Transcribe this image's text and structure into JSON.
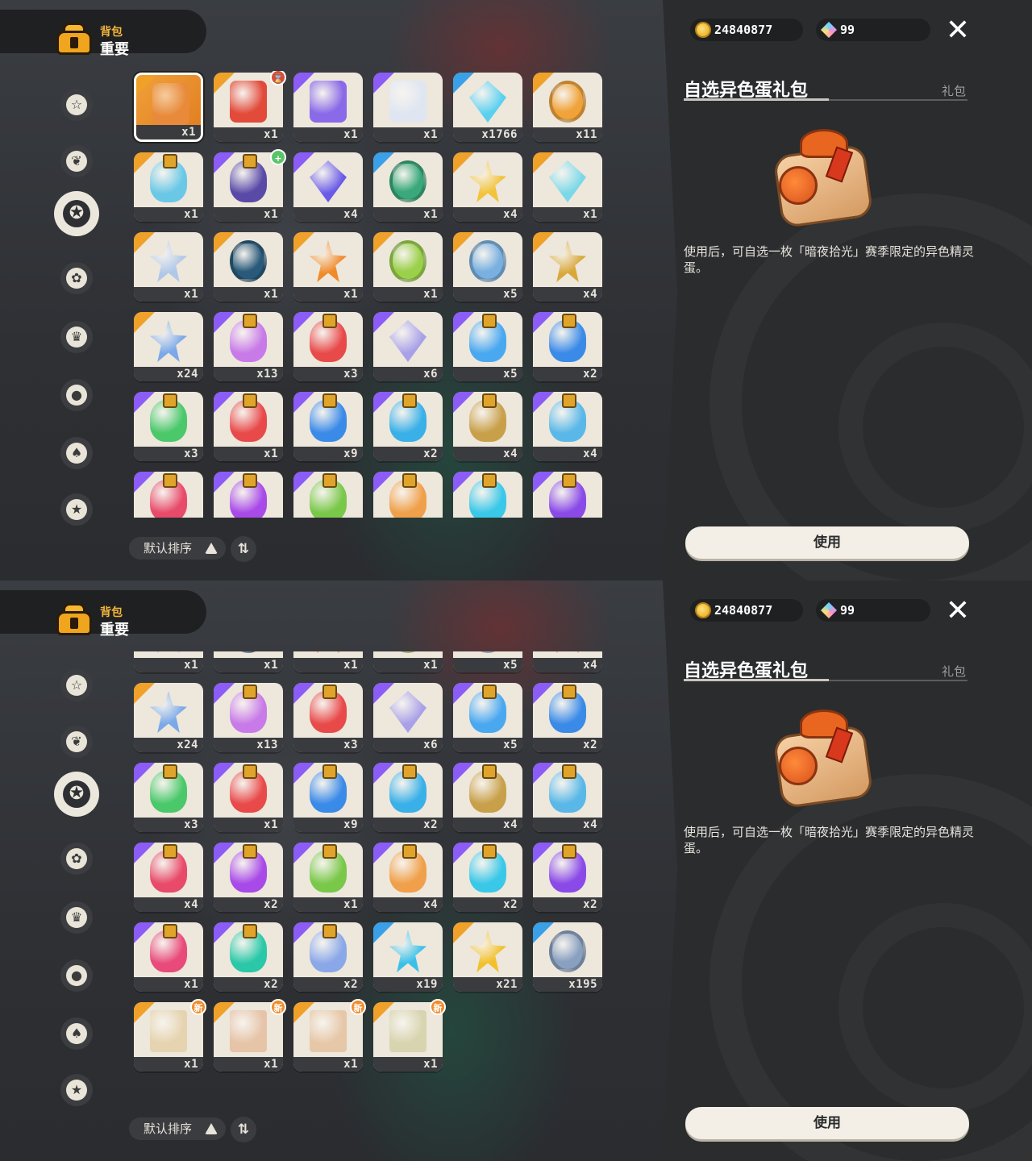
{
  "header": {
    "subtitle": "背包",
    "title": "重要"
  },
  "currency": {
    "gold": "24840877",
    "gems": "99"
  },
  "detail": {
    "name": "自选异色蛋礼包",
    "type": "礼包",
    "description": "使用后，可自选一枚「暗夜拾光」赛季限定的异色精灵蛋。",
    "use_label": "使用"
  },
  "sort": {
    "label": "默认排序",
    "toggle_glyph": "⇅"
  },
  "categories": [
    {
      "icon": "star-outline-icon",
      "glyph": "☆"
    },
    {
      "icon": "leaf-icon",
      "glyph": "❦"
    },
    {
      "icon": "star-burst-icon",
      "glyph": "✪"
    },
    {
      "icon": "flower-leaf-icon",
      "glyph": "✿"
    },
    {
      "icon": "card-crown-icon",
      "glyph": "♛"
    },
    {
      "icon": "egg-dots-icon",
      "glyph": "●"
    },
    {
      "icon": "acorn-icon",
      "glyph": "♠"
    },
    {
      "icon": "sofa-icon",
      "glyph": "★"
    }
  ],
  "rows": [
    [
      {
        "c": "x1",
        "k": "box",
        "col": "#e88a3a",
        "rar": "#f0a12a",
        "sel": true
      },
      {
        "c": "x1",
        "k": "box",
        "col": "#e24a3a",
        "rar": "#f0a12a",
        "badge": "timer"
      },
      {
        "c": "x1",
        "k": "box",
        "col": "#8a6ae8",
        "rar": "#8b5cf6"
      },
      {
        "c": "x1",
        "k": "box",
        "col": "#dfe6f2",
        "rar": "#8b5cf6"
      },
      {
        "c": "x1766",
        "k": "gem",
        "col": "#5ad0f0",
        "rar": "#3aa0e8"
      },
      {
        "c": "x11",
        "k": "coin",
        "col": "#f0a33a",
        "rar": "#f0a12a"
      }
    ],
    [
      {
        "c": "x1",
        "k": "bottle",
        "col": "#6ac8e6",
        "rar": "#f0a12a"
      },
      {
        "c": "x1",
        "k": "bottle",
        "col": "#5a4aa8",
        "rar": "#8b5cf6",
        "badge": "up"
      },
      {
        "c": "x4",
        "k": "gem",
        "col": "#6a5ae8",
        "rar": "#8b5cf6"
      },
      {
        "c": "x1",
        "k": "coin",
        "col": "#3aa87a",
        "rar": "#3aa0e8"
      },
      {
        "c": "x4",
        "k": "star",
        "col": "#f2c33a",
        "rar": "#f0a12a"
      },
      {
        "c": "x1",
        "k": "gem",
        "col": "#7ad8e8",
        "rar": "#f0a12a"
      }
    ],
    [
      {
        "c": "x1",
        "k": "star",
        "col": "#b0c8e8",
        "rar": "#f0a12a"
      },
      {
        "c": "x1",
        "k": "coin",
        "col": "#2a5a7a",
        "rar": "#f0a12a"
      },
      {
        "c": "x1",
        "k": "star",
        "col": "#f08a2a",
        "rar": "#f0a12a"
      },
      {
        "c": "x1",
        "k": "coin",
        "col": "#9ad04a",
        "rar": "#f0a12a"
      },
      {
        "c": "x5",
        "k": "coin",
        "col": "#7ab0e0",
        "rar": "#f0a12a"
      },
      {
        "c": "x4",
        "k": "star",
        "col": "#d8a83a",
        "rar": "#f0a12a"
      }
    ],
    [
      {
        "c": "x24",
        "k": "star",
        "col": "#7aa8e8",
        "rar": "#f0a12a"
      },
      {
        "c": "x13",
        "k": "bottle",
        "col": "#c87ae8",
        "rar": "#8b5cf6"
      },
      {
        "c": "x3",
        "k": "bottle",
        "col": "#e84a4a",
        "rar": "#8b5cf6"
      },
      {
        "c": "x6",
        "k": "gem",
        "col": "#a8a0e8",
        "rar": "#8b5cf6"
      },
      {
        "c": "x5",
        "k": "bottle",
        "col": "#4aa8f0",
        "rar": "#8b5cf6"
      },
      {
        "c": "x2",
        "k": "bottle",
        "col": "#3a8ae8",
        "rar": "#8b5cf6"
      }
    ],
    [
      {
        "c": "x3",
        "k": "bottle",
        "col": "#4ac86a",
        "rar": "#8b5cf6"
      },
      {
        "c": "x1",
        "k": "bottle",
        "col": "#e84a4a",
        "rar": "#8b5cf6"
      },
      {
        "c": "x9",
        "k": "bottle",
        "col": "#3a8ae8",
        "rar": "#8b5cf6"
      },
      {
        "c": "x2",
        "k": "bottle",
        "col": "#3ab0e8",
        "rar": "#8b5cf6"
      },
      {
        "c": "x4",
        "k": "bottle",
        "col": "#c8a04a",
        "rar": "#8b5cf6"
      },
      {
        "c": "x4",
        "k": "bottle",
        "col": "#5ab8e8",
        "rar": "#8b5cf6"
      }
    ],
    [
      {
        "c": "x4",
        "k": "bottle",
        "col": "#e84a6a",
        "rar": "#8b5cf6"
      },
      {
        "c": "x2",
        "k": "bottle",
        "col": "#a84ae8",
        "rar": "#8b5cf6"
      },
      {
        "c": "x1",
        "k": "bottle",
        "col": "#7ac84a",
        "rar": "#8b5cf6"
      },
      {
        "c": "x4",
        "k": "bottle",
        "col": "#f0a04a",
        "rar": "#8b5cf6"
      },
      {
        "c": "x2",
        "k": "bottle",
        "col": "#3ac8e8",
        "rar": "#8b5cf6"
      },
      {
        "c": "x2",
        "k": "bottle",
        "col": "#8a4ae8",
        "rar": "#8b5cf6"
      }
    ],
    [
      {
        "c": "x1",
        "k": "bottle",
        "col": "#e84a7a",
        "rar": "#8b5cf6"
      },
      {
        "c": "x2",
        "k": "bottle",
        "col": "#2ac8a8",
        "rar": "#8b5cf6"
      },
      {
        "c": "x2",
        "k": "bottle",
        "col": "#8aa8e8",
        "rar": "#8b5cf6"
      },
      {
        "c": "x19",
        "k": "star",
        "col": "#3ac0e8",
        "rar": "#3aa0e8"
      },
      {
        "c": "x21",
        "k": "star",
        "col": "#f2c02a",
        "rar": "#f0a12a"
      },
      {
        "c": "x195",
        "k": "coin",
        "col": "#8aa0c0",
        "rar": "#3aa0e8"
      }
    ],
    [
      {
        "c": "x1",
        "k": "scroll",
        "col": "#e6d4b0",
        "rar": "#f0a12a",
        "badge": "new"
      },
      {
        "c": "x1",
        "k": "scroll",
        "col": "#e6c4a8",
        "rar": "#f0a12a",
        "badge": "new"
      },
      {
        "c": "x1",
        "k": "scroll",
        "col": "#e6c8a8",
        "rar": "#f0a12a",
        "badge": "new"
      },
      {
        "c": "x1",
        "k": "scroll",
        "col": "#d8d4b0",
        "rar": "#f0a12a",
        "badge": "new"
      }
    ]
  ],
  "badges": {
    "new": "新",
    "timer": "⌛",
    "up": "+"
  }
}
